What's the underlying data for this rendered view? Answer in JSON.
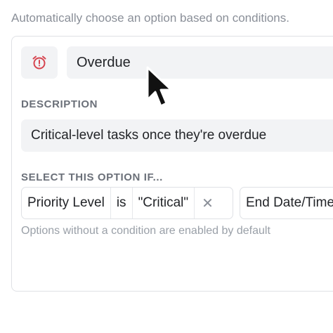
{
  "intro_text": "Automatically choose an option based on conditions.",
  "option": {
    "icon": "alarm-clock-icon",
    "name": "Overdue"
  },
  "description": {
    "label": "DESCRIPTION",
    "value": "Critical-level tasks once they're overdue"
  },
  "conditions": {
    "label": "SELECT THIS OPTION IF...",
    "chips": [
      {
        "field": "Priority Level",
        "operator": "is",
        "value": "\"Critical\"",
        "remove": "✕"
      },
      {
        "field": "End Date/Time"
      }
    ],
    "hint": "Options without a condition are enabled by default"
  },
  "colors": {
    "icon_accent": "#d64550",
    "field_bg": "#f2f3f5",
    "muted_text": "#8a8f98"
  }
}
